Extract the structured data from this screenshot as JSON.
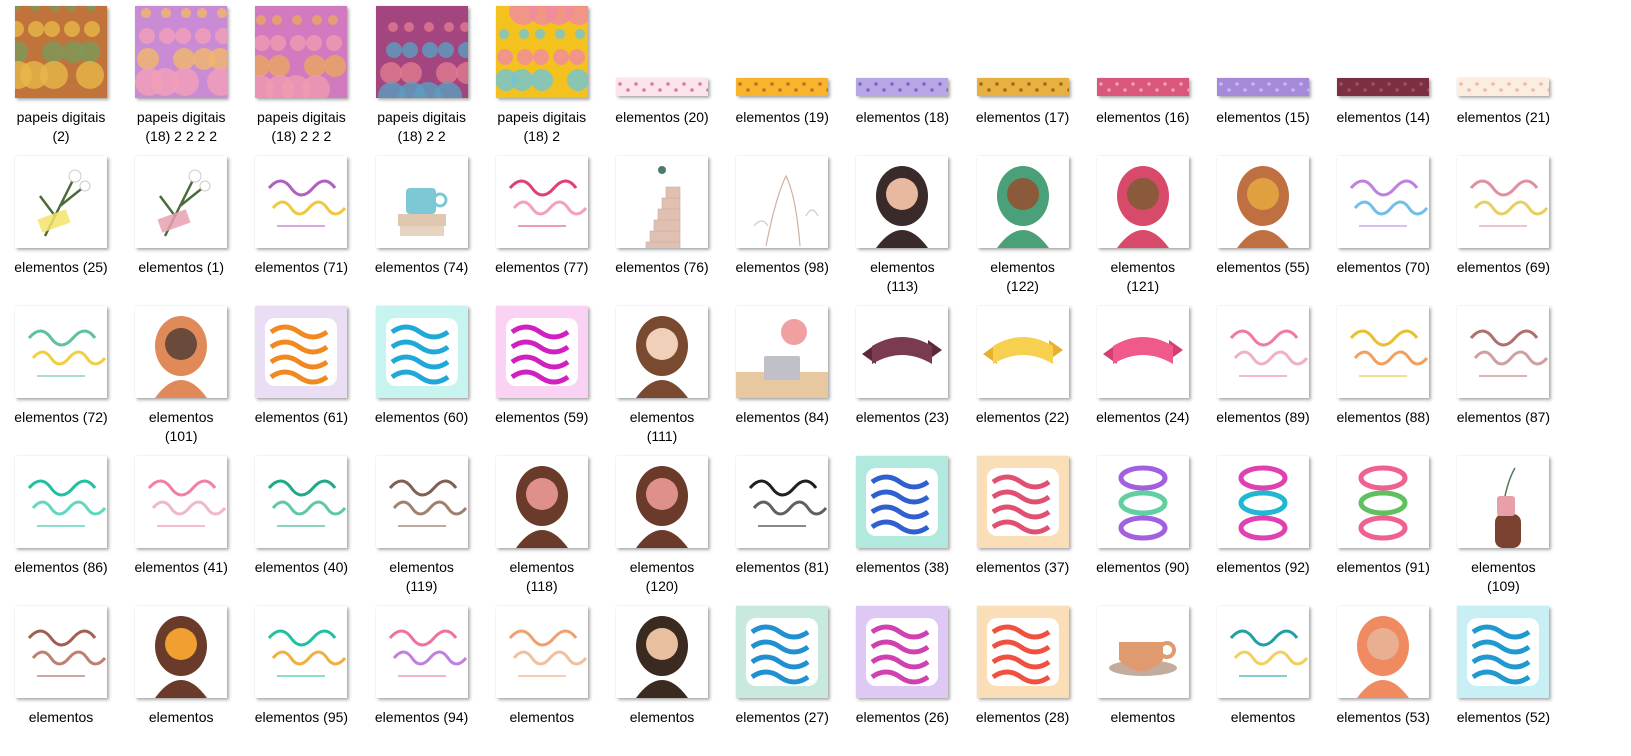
{
  "window": {
    "title": "elementos"
  },
  "items": [
    {
      "name": "papeis digitais (2)",
      "label": "papeis digitais\n(2)",
      "kind": "pattern",
      "colors": [
        "#c0733a",
        "#e6b84a",
        "#7c9a5a"
      ]
    },
    {
      "name": "papeis digitais (18) 2 2 2 2",
      "label": "papeis digitais\n(18) 2 2 2 2",
      "kind": "pattern",
      "colors": [
        "#c88bd4",
        "#f29fb8",
        "#f2b86b"
      ]
    },
    {
      "name": "papeis digitais (18) 2 2 2",
      "label": "papeis digitais\n(18) 2 2 2",
      "kind": "pattern",
      "colors": [
        "#d27ac0",
        "#f09bb0",
        "#e8a860"
      ]
    },
    {
      "name": "papeis digitais (18) 2 2",
      "label": "papeis digitais\n(18) 2 2",
      "kind": "pattern",
      "colors": [
        "#a3457e",
        "#5a9ec0",
        "#e07a90"
      ]
    },
    {
      "name": "papeis digitais (18) 2",
      "label": "papeis digitais\n(18) 2",
      "kind": "pattern",
      "colors": [
        "#f4c21e",
        "#f08aa0",
        "#6fc4d8"
      ]
    },
    {
      "name": "elementos (20)",
      "label": "elementos (20)",
      "kind": "strip",
      "colors": [
        "#fbe4ec",
        "#e07a90"
      ]
    },
    {
      "name": "elementos (19)",
      "label": "elementos (19)",
      "kind": "strip",
      "colors": [
        "#f6b52a",
        "#d0643a"
      ]
    },
    {
      "name": "elementos (18)",
      "label": "elementos (18)",
      "kind": "strip",
      "colors": [
        "#b9a6e6",
        "#7c68c4"
      ]
    },
    {
      "name": "elementos (17)",
      "label": "elementos (17)",
      "kind": "strip",
      "colors": [
        "#e8b040",
        "#9a6a20"
      ]
    },
    {
      "name": "elementos (16)",
      "label": "elementos (16)",
      "kind": "strip",
      "colors": [
        "#d9577a",
        "#f0a0b8"
      ]
    },
    {
      "name": "elementos (15)",
      "label": "elementos (15)",
      "kind": "strip",
      "colors": [
        "#a48ad8",
        "#c9b8ee"
      ]
    },
    {
      "name": "elementos (14)",
      "label": "elementos (14)",
      "kind": "strip",
      "colors": [
        "#7a3040",
        "#b04a5e"
      ]
    },
    {
      "name": "elementos (21)",
      "label": "elementos (21)",
      "kind": "strip",
      "colors": [
        "#fbeee0",
        "#f2b8a0"
      ]
    },
    {
      "name": "elementos (25)",
      "label": "elementos (25)",
      "kind": "flower",
      "colors": [
        "#f5e36a",
        "#4d6b3a"
      ]
    },
    {
      "name": "elementos (1)",
      "label": "elementos (1)",
      "kind": "flower",
      "colors": [
        "#e8a0b0",
        "#4d6b3a"
      ]
    },
    {
      "name": "elementos (71)",
      "label": "elementos (71)",
      "kind": "lettering",
      "colors": [
        "#b060c0",
        "#f0c840"
      ]
    },
    {
      "name": "elementos (74)",
      "label": "elementos (74)",
      "kind": "cup",
      "colors": [
        "#7cc8d4",
        "#e0c8b0"
      ]
    },
    {
      "name": "elementos (77)",
      "label": "elementos (77)",
      "kind": "lettering",
      "colors": [
        "#e0407a",
        "#f5a0c0"
      ]
    },
    {
      "name": "elementos (76)",
      "label": "elementos (76)",
      "kind": "stairs",
      "colors": [
        "#e0c0b0",
        "#4a7a6a"
      ]
    },
    {
      "name": "elementos (98)",
      "label": "elementos (98)",
      "kind": "lineart",
      "colors": [
        "#d0b0a0",
        "#c8d0c0"
      ]
    },
    {
      "name": "elementos (113)",
      "label": "elementos\n(113)",
      "kind": "woman",
      "colors": [
        "#3a2a2a",
        "#e8b8a0"
      ]
    },
    {
      "name": "elementos (122)",
      "label": "elementos\n(122)",
      "kind": "woman",
      "colors": [
        "#4aa078",
        "#8a5a3a"
      ]
    },
    {
      "name": "elementos (121)",
      "label": "elementos\n(121)",
      "kind": "woman",
      "colors": [
        "#d84a6a",
        "#8a5a3a"
      ]
    },
    {
      "name": "elementos (55)",
      "label": "elementos (55)",
      "kind": "woman",
      "colors": [
        "#c07040",
        "#e0a040"
      ]
    },
    {
      "name": "elementos (70)",
      "label": "elementos (70)",
      "kind": "lettering",
      "colors": [
        "#c080e0",
        "#70c0e8"
      ]
    },
    {
      "name": "elementos (69)",
      "label": "elementos (69)",
      "kind": "lettering",
      "colors": [
        "#e090a0",
        "#e8d060"
      ]
    },
    {
      "name": "elementos (72)",
      "label": "elementos (72)",
      "kind": "lettering",
      "colors": [
        "#60c0a0",
        "#f0d040"
      ]
    },
    {
      "name": "elementos (101)",
      "label": "elementos\n(101)",
      "kind": "woman",
      "colors": [
        "#e08a5a",
        "#6a4a3a"
      ]
    },
    {
      "name": "elementos (61)",
      "label": "elementos (61)",
      "kind": "bold",
      "colors": [
        "#f08a20",
        "#c0a0e0"
      ]
    },
    {
      "name": "elementos (60)",
      "label": "elementos (60)",
      "kind": "bold",
      "colors": [
        "#20a8d8",
        "#60e0d0"
      ]
    },
    {
      "name": "elementos (59)",
      "label": "elementos (59)",
      "kind": "bold",
      "colors": [
        "#d020c0",
        "#f080e0"
      ]
    },
    {
      "name": "elementos (111)",
      "label": "elementos\n(111)",
      "kind": "woman",
      "colors": [
        "#7a4a30",
        "#f0d0b8"
      ]
    },
    {
      "name": "elementos (84)",
      "label": "elementos (84)",
      "kind": "laptop",
      "colors": [
        "#f0a0a0",
        "#c0c0c8"
      ]
    },
    {
      "name": "elementos (23)",
      "label": "elementos (23)",
      "kind": "ribbon",
      "colors": [
        "#7a3a50",
        "#5a2a3a"
      ]
    },
    {
      "name": "elementos (22)",
      "label": "elementos (22)",
      "kind": "ribbon",
      "colors": [
        "#f8d050",
        "#e8b030"
      ]
    },
    {
      "name": "elementos (24)",
      "label": "elementos (24)",
      "kind": "ribbon",
      "colors": [
        "#f05a8a",
        "#d04070"
      ]
    },
    {
      "name": "elementos (89)",
      "label": "elementos (89)",
      "kind": "lettering",
      "colors": [
        "#f07aa0",
        "#f0b0c8"
      ]
    },
    {
      "name": "elementos (88)",
      "label": "elementos (88)",
      "kind": "lettering",
      "colors": [
        "#e8c030",
        "#f0a060"
      ]
    },
    {
      "name": "elementos (87)",
      "label": "elementos (87)",
      "kind": "lettering",
      "colors": [
        "#b07070",
        "#d0a0a0"
      ]
    },
    {
      "name": "elementos (86)",
      "label": "elementos (86)",
      "kind": "lettering",
      "colors": [
        "#20c0a0",
        "#60d8c0"
      ]
    },
    {
      "name": "elementos (41)",
      "label": "elementos (41)",
      "kind": "lettering",
      "colors": [
        "#f080a8",
        "#f0b8c8"
      ]
    },
    {
      "name": "elementos (40)",
      "label": "elementos (40)",
      "kind": "lettering",
      "colors": [
        "#20a888",
        "#60c8a8"
      ]
    },
    {
      "name": "elementos (119)",
      "label": "elementos\n(119)",
      "kind": "lettering",
      "colors": [
        "#806050",
        "#a08070"
      ]
    },
    {
      "name": "elementos (118)",
      "label": "elementos\n(118)",
      "kind": "woman",
      "colors": [
        "#6a3a2a",
        "#e0908a"
      ]
    },
    {
      "name": "elementos (120)",
      "label": "elementos\n(120)",
      "kind": "woman",
      "colors": [
        "#6a3a2a",
        "#e0908a"
      ]
    },
    {
      "name": "elementos (81)",
      "label": "elementos (81)",
      "kind": "lettering",
      "colors": [
        "#202020",
        "#606060"
      ]
    },
    {
      "name": "elementos (38)",
      "label": "elementos (38)",
      "kind": "bold",
      "colors": [
        "#3060d0",
        "#20c0a0"
      ]
    },
    {
      "name": "elementos (37)",
      "label": "elementos (37)",
      "kind": "bold",
      "colors": [
        "#e05070",
        "#f0a030"
      ]
    },
    {
      "name": "elementos (90)",
      "label": "elementos (90)",
      "kind": "ore",
      "colors": [
        "#a060e0",
        "#60d0a0"
      ]
    },
    {
      "name": "elementos (92)",
      "label": "elementos (92)",
      "kind": "ore",
      "colors": [
        "#e040b0",
        "#20b8d0"
      ]
    },
    {
      "name": "elementos (91)",
      "label": "elementos (91)",
      "kind": "ore",
      "colors": [
        "#f06090",
        "#60c060"
      ]
    },
    {
      "name": "elementos (109)",
      "label": "elementos\n(109)",
      "kind": "hand",
      "colors": [
        "#7a4030",
        "#e8a0a8"
      ]
    },
    {
      "name": "elementos",
      "label": "elementos",
      "kind": "lettering",
      "colors": [
        "#a06050",
        "#c08070"
      ]
    },
    {
      "name": "elementos",
      "label": "elementos",
      "kind": "woman",
      "colors": [
        "#6a3a2a",
        "#f0a030"
      ]
    },
    {
      "name": "elementos (95)",
      "label": "elementos (95)",
      "kind": "lettering",
      "colors": [
        "#20c0a0",
        "#f0b040"
      ]
    },
    {
      "name": "elementos (94)",
      "label": "elementos (94)",
      "kind": "lettering",
      "colors": [
        "#f070a0",
        "#c080e0"
      ]
    },
    {
      "name": "elementos",
      "label": "elementos",
      "kind": "lettering",
      "colors": [
        "#f0a070",
        "#f0c0a0"
      ]
    },
    {
      "name": "elementos",
      "label": "elementos",
      "kind": "woman",
      "colors": [
        "#3a2a20",
        "#e8c0a0"
      ]
    },
    {
      "name": "elementos (27)",
      "label": "elementos (27)",
      "kind": "bold",
      "colors": [
        "#2090d0",
        "#60c0a0"
      ]
    },
    {
      "name": "elementos (26)",
      "label": "elementos (26)",
      "kind": "bold",
      "colors": [
        "#d040b0",
        "#a060e0"
      ]
    },
    {
      "name": "elementos (28)",
      "label": "elementos (28)",
      "kind": "bold",
      "colors": [
        "#f05040",
        "#f0a030"
      ]
    },
    {
      "name": "elementos",
      "label": "elementos",
      "kind": "coffee",
      "colors": [
        "#e09a70",
        "#8a5a3a"
      ]
    },
    {
      "name": "elementos",
      "label": "elementos",
      "kind": "lettering",
      "colors": [
        "#20a0a0",
        "#f0d060"
      ]
    },
    {
      "name": "elementos (53)",
      "label": "elementos (53)",
      "kind": "woman",
      "colors": [
        "#f08a60",
        "#e8b090"
      ]
    },
    {
      "name": "elementos (52)",
      "label": "elementos (52)",
      "kind": "bold",
      "colors": [
        "#2098d0",
        "#60d0e0"
      ]
    }
  ]
}
